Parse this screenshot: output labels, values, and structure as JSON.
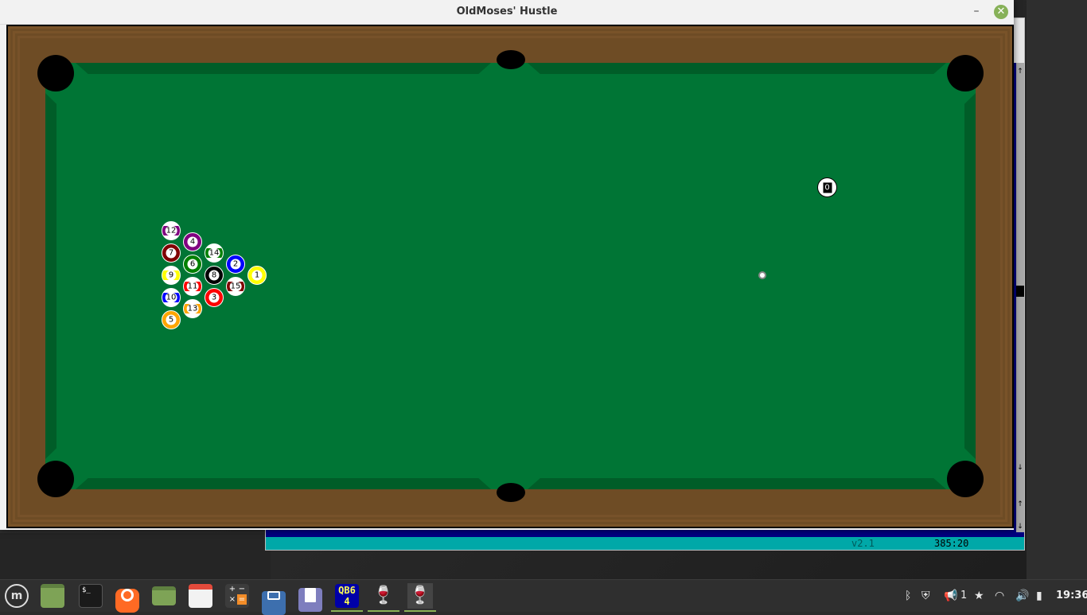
{
  "window": {
    "title": "OldMoses' Hustle",
    "minimize": "–",
    "close": "✕"
  },
  "background_ide": {
    "version": "v2.1",
    "cursor_pos": "385:20"
  },
  "balls": [
    {
      "n": "12",
      "color": "#800080",
      "stripe": true
    },
    {
      "n": "4",
      "color": "#800080",
      "stripe": false
    },
    {
      "n": "7",
      "color": "#800000",
      "stripe": false
    },
    {
      "n": "14",
      "color": "#008000",
      "stripe": true
    },
    {
      "n": "6",
      "color": "#008000",
      "stripe": false
    },
    {
      "n": "2",
      "color": "#0000ff",
      "stripe": false
    },
    {
      "n": "9",
      "color": "#ffff00",
      "stripe": true
    },
    {
      "n": "8",
      "color": "#000000",
      "stripe": false
    },
    {
      "n": "1",
      "color": "#ffff00",
      "stripe": false
    },
    {
      "n": "11",
      "color": "#ff0000",
      "stripe": true
    },
    {
      "n": "15",
      "color": "#800000",
      "stripe": true
    },
    {
      "n": "10",
      "color": "#0000ff",
      "stripe": true
    },
    {
      "n": "3",
      "color": "#ff0000",
      "stripe": false
    },
    {
      "n": "13",
      "color": "#ffa500",
      "stripe": true
    },
    {
      "n": "5",
      "color": "#ffa500",
      "stripe": false
    }
  ],
  "cue_ball": {
    "n": "0"
  },
  "colors": {
    "felt": "#007535",
    "cushion": "#005d28",
    "rail": "#6e4c25"
  },
  "taskbar": {
    "items": [
      {
        "name": "mint-menu-icon"
      },
      {
        "name": "show-desktop-icon"
      },
      {
        "name": "terminal-icon",
        "glyph": "$_"
      },
      {
        "name": "firefox-icon"
      },
      {
        "name": "files-icon"
      },
      {
        "name": "calendar-icon"
      },
      {
        "name": "calculator-icon"
      },
      {
        "name": "screenshot-icon"
      },
      {
        "name": "text-editor-icon"
      },
      {
        "name": "qb64-icon",
        "glyph": "QB64"
      },
      {
        "name": "wine-icon"
      },
      {
        "name": "wine-icon"
      }
    ],
    "tray": {
      "notification_count": "1",
      "clock": "19:36"
    }
  }
}
